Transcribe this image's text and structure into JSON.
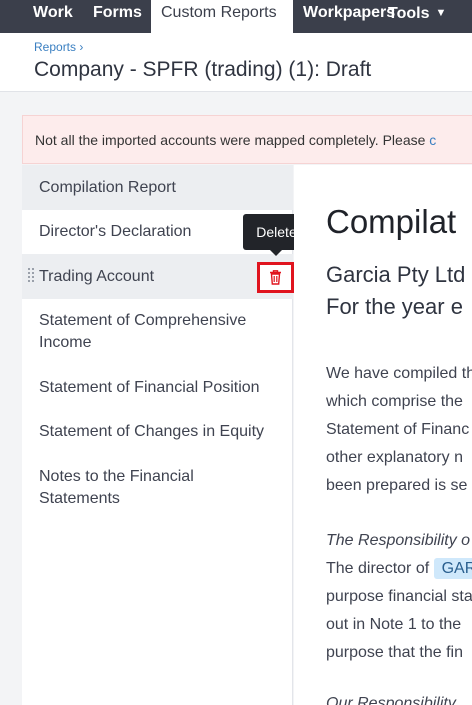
{
  "nav": {
    "tabs": [
      {
        "label": "Work"
      },
      {
        "label": "Forms"
      },
      {
        "label": "Custom Reports"
      },
      {
        "label": "Workpapers"
      },
      {
        "label": "Tools"
      }
    ]
  },
  "header": {
    "breadcrumb": "Reports ›",
    "title": "Company - SPFR (trading) (1): Draft"
  },
  "alert": {
    "text": "Not all the imported accounts were mapped completely. Please ",
    "link": "c"
  },
  "sidebar": {
    "items": [
      {
        "label": "Compilation Report"
      },
      {
        "label": "Director's Declaration"
      },
      {
        "label": "Trading Account"
      },
      {
        "label_line1": "Statement of Comprehensive",
        "label_line2": "Income"
      },
      {
        "label": "Statement of Financial Position"
      },
      {
        "label": "Statement of Changes in Equity"
      },
      {
        "label_line1": "Notes to the Financial",
        "label_line2": "Statements"
      }
    ],
    "delete_tooltip": "Delete"
  },
  "doc": {
    "heading": "Compilat",
    "subheading1": "Garcia Pty Ltd",
    "subheading2": "For the year e",
    "para1": [
      "We have compiled th",
      "which comprise the",
      "Statement of Financ",
      "other explanatory n",
      "been prepared is se"
    ],
    "resp_heading": "The Responsibility o",
    "resp_line1_prefix": "The director of ",
    "resp_highlight": "GAR",
    "resp_lines": [
      "purpose financial sta",
      "out in Note 1 to the",
      "purpose that the fin"
    ],
    "our_resp": "Our Responsibility"
  },
  "colors": {
    "nav_bg": "#3b3f4b",
    "link": "#3a7fc1",
    "alert_bg": "#fdecec",
    "delete_highlight": "#e0141e"
  }
}
